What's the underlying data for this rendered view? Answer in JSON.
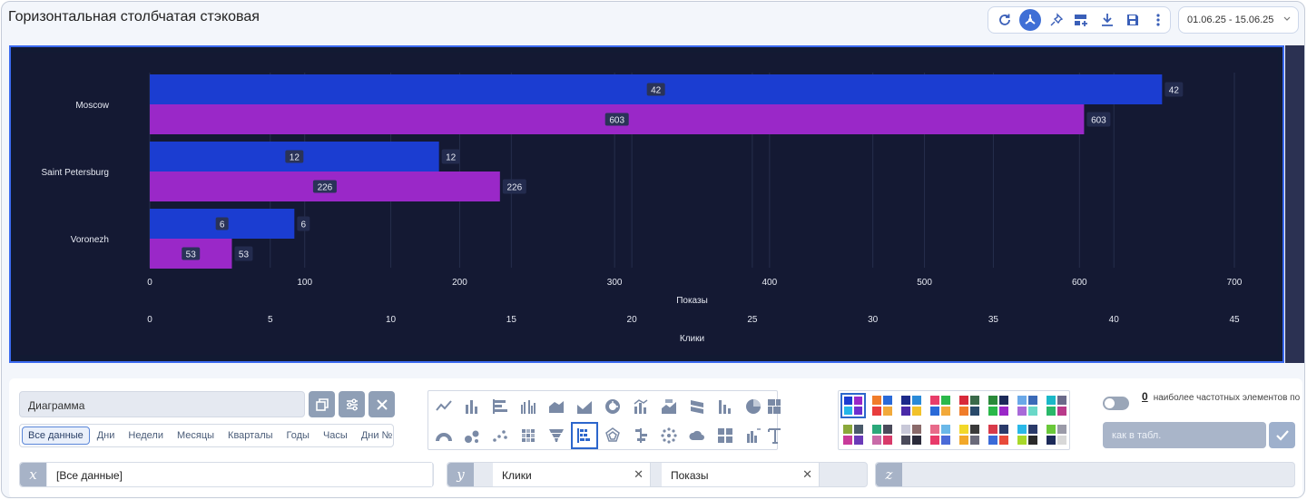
{
  "header": {
    "title": "Горизонтальная столбчатая стэковая",
    "date_range": "01.06.25 - 15.06.25"
  },
  "toolbar": {
    "icons": [
      "refresh-icon",
      "share-icon",
      "pin-icon",
      "add-widget-icon",
      "download-icon",
      "save-icon",
      "more-icon"
    ]
  },
  "chart_data": {
    "type": "bar",
    "orientation": "horizontal",
    "categories": [
      "Moscow",
      "Saint Petersburg",
      "Voronezh"
    ],
    "series": [
      {
        "name": "Клики",
        "values": [
          42,
          12,
          6
        ],
        "color": "#1b3dd1",
        "axis": "Клики"
      },
      {
        "name": "Показы",
        "values": [
          603,
          226,
          53
        ],
        "color": "#9a28c8",
        "axis": "Показы"
      }
    ],
    "axes": [
      {
        "label": "Показы",
        "ticks": [
          "0",
          "100",
          "200",
          "300",
          "400",
          "500",
          "600",
          "700"
        ],
        "range": [
          0,
          700
        ]
      },
      {
        "label": "Клики",
        "ticks": [
          "0",
          "5",
          "10",
          "15",
          "20",
          "25",
          "30",
          "35",
          "40",
          "45"
        ],
        "range": [
          0,
          45
        ]
      }
    ]
  },
  "panel": {
    "name_value": "Диаграмма",
    "periods": [
      "Все данные",
      "Дни",
      "Недели",
      "Месяцы",
      "Кварталы",
      "Годы",
      "Часы",
      "Дни №"
    ],
    "topn_count": "0",
    "topn_text": "наиболее частотных элементов по",
    "topn_placeholder": "как в табл.",
    "x_axis": {
      "label": "x",
      "value": "[Все данные]"
    },
    "y_axis": {
      "label": "y",
      "fields": [
        "Клики",
        "Показы"
      ]
    },
    "z_axis": {
      "label": "z"
    }
  }
}
